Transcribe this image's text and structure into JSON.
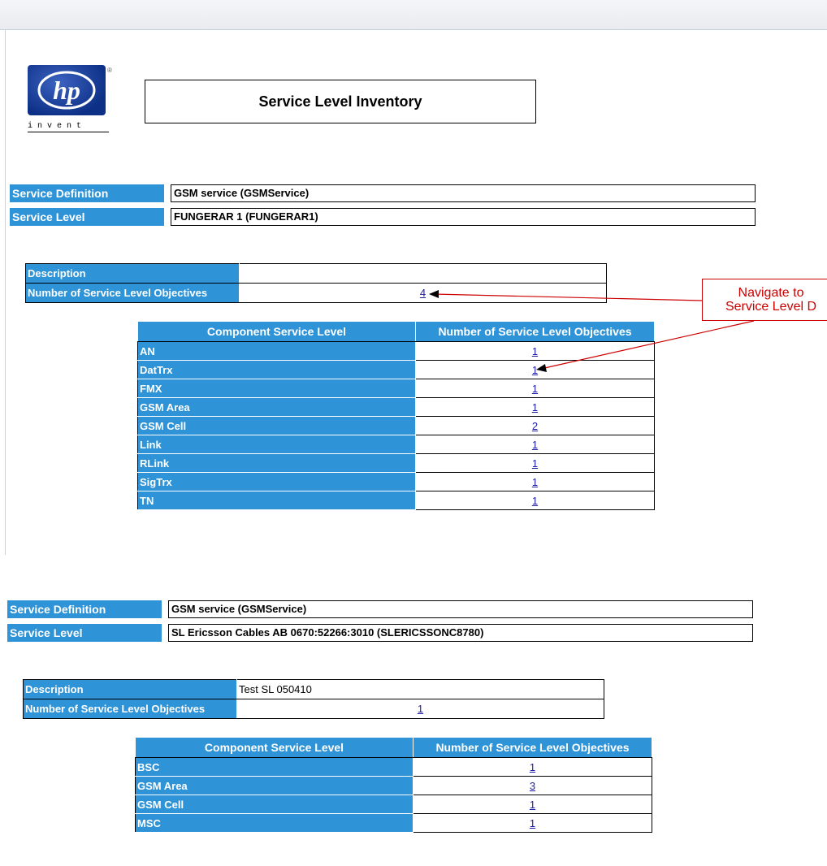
{
  "header": {
    "logo_text": "hp",
    "tagline": "invent",
    "title": "Service Level Inventory"
  },
  "callout": {
    "line1": "Navigate to",
    "line2": "Service Level D"
  },
  "sections": [
    {
      "service_definition_label": "Service Definition",
      "service_definition_value": "GSM service (GSMService)",
      "service_level_label": "Service Level",
      "service_level_value": "FUNGERAR 1 (FUNGERAR1)",
      "description_label": "Description",
      "description_value": "",
      "objectives_label": "Number of Service Level Objectives",
      "objectives_value": "4",
      "table_headers": [
        "Component Service Level",
        "Number of Service Level Objectives"
      ],
      "rows": [
        {
          "name": "AN",
          "count": "1"
        },
        {
          "name": "DatTrx",
          "count": "1"
        },
        {
          "name": "FMX",
          "count": "1"
        },
        {
          "name": "GSM Area",
          "count": "1"
        },
        {
          "name": "GSM Cell",
          "count": "2"
        },
        {
          "name": "Link",
          "count": "1"
        },
        {
          "name": "RLink",
          "count": "1"
        },
        {
          "name": "SigTrx",
          "count": "1"
        },
        {
          "name": "TN",
          "count": "1"
        }
      ]
    },
    {
      "service_definition_label": "Service Definition",
      "service_definition_value": "GSM service (GSMService)",
      "service_level_label": "Service Level",
      "service_level_value": "SL Ericsson Cables AB 0670:52266:3010 (SLERICSSONC8780)",
      "description_label": "Description",
      "description_value": "Test SL 050410",
      "objectives_label": "Number of Service Level Objectives",
      "objectives_value": "1",
      "table_headers": [
        "Component Service Level",
        "Number of Service Level Objectives"
      ],
      "rows": [
        {
          "name": "BSC",
          "count": "1"
        },
        {
          "name": "GSM Area",
          "count": "3"
        },
        {
          "name": "GSM Cell",
          "count": "1"
        },
        {
          "name": "MSC",
          "count": "1"
        }
      ]
    }
  ],
  "colors": {
    "label_bg": "#2f93d7",
    "link": "#1a1aa6",
    "annotation": "#cc0000"
  }
}
